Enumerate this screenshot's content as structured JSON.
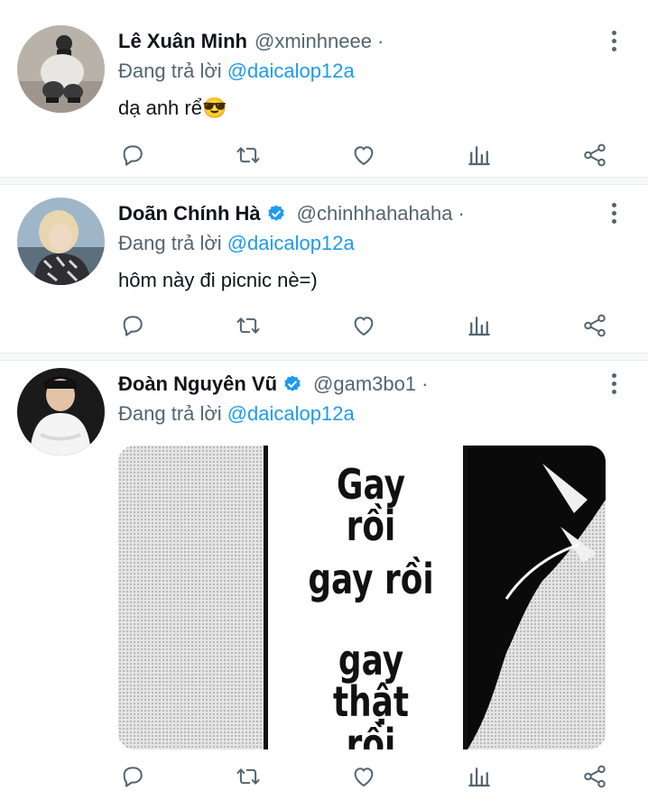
{
  "colors": {
    "text": "#0f1419",
    "secondary": "#536471",
    "link": "#1d9bf0",
    "divider": "#f7f9f9"
  },
  "reply_prefix": "Đang trả lời",
  "tweets": [
    {
      "name": "Lê Xuân Minh",
      "handle": "@xminhneee",
      "separator": "·",
      "verified": false,
      "reply_to": "@daicalop12a",
      "text": "dạ anh rể😎",
      "avatar_icon": "avatar-photo-crouching-person"
    },
    {
      "name": "Doãn Chính Hà",
      "handle": "@chinhhahahaha",
      "separator": "·",
      "verified": true,
      "reply_to": "@daicalop12a",
      "text": "hôm này đi picnic nè=)",
      "avatar_icon": "avatar-photo-blonde-person"
    },
    {
      "name": "Đoàn Nguyên Vũ",
      "handle": "@gam3bo1",
      "separator": "·",
      "verified": true,
      "reply_to": "@daicalop12a",
      "text": "",
      "avatar_icon": "avatar-photo-person-white-shirt",
      "media_text": [
        "Gay rồi",
        "gay rồi",
        "gay thật",
        "rồi"
      ]
    }
  ],
  "action_icons": [
    "reply-icon",
    "retweet-icon",
    "like-icon",
    "analytics-icon",
    "share-icon"
  ]
}
